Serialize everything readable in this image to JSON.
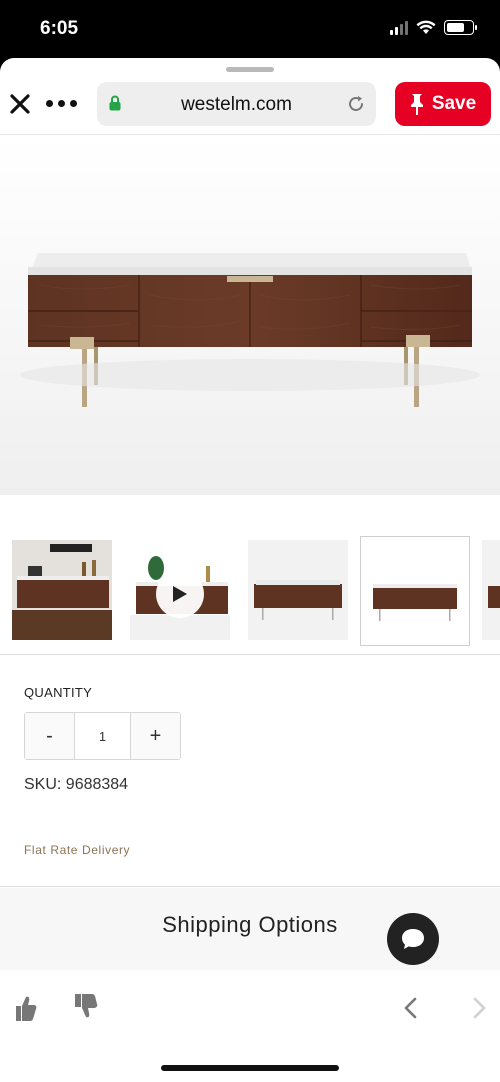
{
  "status_bar": {
    "time": "6:05"
  },
  "browser": {
    "url": "westelm.com",
    "save_label": "Save"
  },
  "product": {
    "quantity_label": "QUANTITY",
    "quantity_decrement": "-",
    "quantity_value": "1",
    "quantity_increment": "+",
    "sku": "SKU: 9688384",
    "flat_rate": "Flat Rate Delivery",
    "shipping_options": "Shipping Options"
  },
  "colors": {
    "save_red": "#e60023",
    "walnut": "#5a2f20",
    "brass": "#b9a584",
    "accent_text": "#8c7355"
  },
  "icons": [
    "close-icon",
    "more-icon",
    "lock-icon",
    "reload-icon",
    "pin-icon",
    "play-icon",
    "chat-icon",
    "thumbs-up-icon",
    "thumbs-down-icon",
    "back-icon",
    "forward-icon"
  ]
}
